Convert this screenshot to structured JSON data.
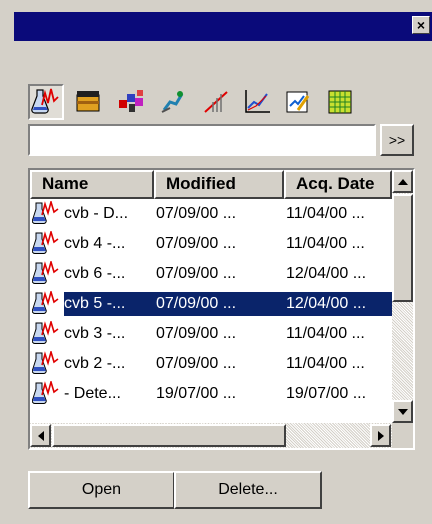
{
  "window": {
    "close_label": "×"
  },
  "toolbar": {
    "tools": [
      {
        "icon": "spectrum-flask-icon",
        "pressed": true
      },
      {
        "icon": "box-icon"
      },
      {
        "icon": "molecule-icon"
      },
      {
        "icon": "runner-icon"
      },
      {
        "icon": "calibration-curve-icon"
      },
      {
        "icon": "xy-plot-icon"
      },
      {
        "icon": "report-edit-icon"
      },
      {
        "icon": "spreadsheet-icon"
      }
    ]
  },
  "search": {
    "value": "",
    "go_label": ">>"
  },
  "list": {
    "columns": [
      "Name",
      "Modified",
      "Acq. Date"
    ],
    "rows": [
      {
        "name": "cvb - D...",
        "modified": "07/09/00 ...",
        "acq": "11/04/00 ..."
      },
      {
        "name": "cvb 4 -...",
        "modified": "07/09/00 ...",
        "acq": "11/04/00 ..."
      },
      {
        "name": "cvb 6 -...",
        "modified": "07/09/00 ...",
        "acq": "12/04/00 ..."
      },
      {
        "name": "cvb 5 -...",
        "modified": "07/09/00 ...",
        "acq": "12/04/00 ...",
        "selected": true
      },
      {
        "name": "cvb 3 -...",
        "modified": "07/09/00 ...",
        "acq": "11/04/00 ..."
      },
      {
        "name": "cvb 2 -...",
        "modified": "07/09/00 ...",
        "acq": "11/04/00 ..."
      },
      {
        "name": " - Dete...",
        "modified": "19/07/00 ...",
        "acq": "19/07/00 ..."
      }
    ]
  },
  "buttons": {
    "open_label": "Open",
    "delete_label": "Delete..."
  },
  "colors": {
    "titlebar": "#0a0a7a",
    "selection": "#0a246a",
    "face": "#d4d0c8"
  }
}
